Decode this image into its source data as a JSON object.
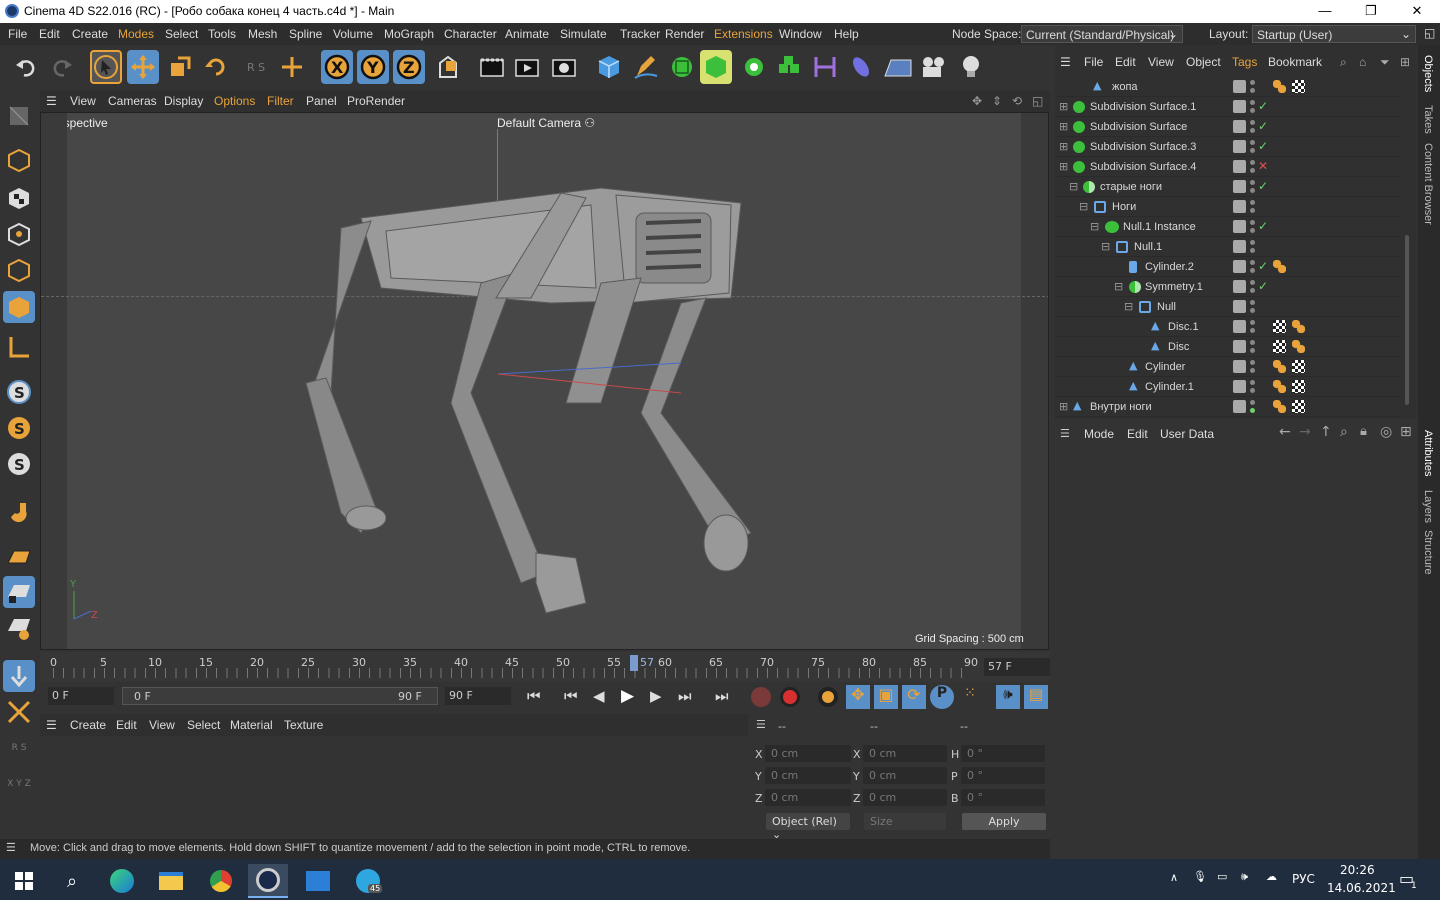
{
  "window": {
    "title": "Cinema 4D S22.016 (RC) - [Робо собака конец 4 часть.c4d *] - Main",
    "minimize": "—",
    "restore": "❐",
    "close": "✕"
  },
  "menubar": {
    "items": [
      "File",
      "Edit",
      "Create",
      "Modes",
      "Select",
      "Tools",
      "Mesh",
      "Spline",
      "Volume",
      "MoGraph",
      "Character",
      "Animate",
      "Simulate",
      "Tracker",
      "Render",
      "Extensions",
      "Window",
      "Help"
    ],
    "node_space_label": "Node Space:",
    "node_space_value": "Current (Standard/Physical)",
    "layout_label": "Layout:",
    "layout_value": "Startup (User)"
  },
  "toolbar": {
    "icons": [
      "undo-icon",
      "redo-icon",
      "select-arrow-icon",
      "move-icon",
      "scale-icon",
      "rotate-icon",
      "coord-system-icon",
      "recent-tool-icon",
      "x-axis-icon",
      "y-axis-icon",
      "z-axis-icon",
      "world-coord-icon",
      "render-region-icon",
      "render-view-icon",
      "render-settings-icon",
      "cube-icon",
      "pen-icon",
      "subdivision-icon",
      "extrude-icon",
      "cloner-icon",
      "boole-icon",
      "deformer-icon",
      "spline-mask-icon",
      "floor-icon",
      "camera-icon",
      "light-icon"
    ]
  },
  "viewport": {
    "menu": [
      "View",
      "Cameras",
      "Display",
      "Options",
      "Filter",
      "Panel",
      "ProRender"
    ],
    "label": "Perspective",
    "camera": "Default Camera",
    "grid_spacing": "Grid Spacing : 500 cm",
    "axis_y": "Y",
    "axis_z": "Z"
  },
  "timeline": {
    "ticks": [
      "0",
      "5",
      "10",
      "15",
      "20",
      "25",
      "30",
      "35",
      "40",
      "45",
      "50",
      "55",
      "60",
      "65",
      "70",
      "75",
      "80",
      "85",
      "90"
    ],
    "current_marker": "57",
    "current_frame": "57 F"
  },
  "playbar": {
    "start": "0 F",
    "range_start": "0 F",
    "range_end": "90 F",
    "end": "90 F"
  },
  "material_menu": [
    "Create",
    "Edit",
    "View",
    "Select",
    "Material",
    "Texture"
  ],
  "coords": {
    "headers": [
      "--",
      "--",
      "--"
    ],
    "rows": [
      {
        "a": "X",
        "av": "0 cm",
        "b": "X",
        "bv": "0 cm",
        "c": "H",
        "cv": "0 °"
      },
      {
        "a": "Y",
        "av": "0 cm",
        "b": "Y",
        "bv": "0 cm",
        "c": "P",
        "cv": "0 °"
      },
      {
        "a": "Z",
        "av": "0 cm",
        "b": "Z",
        "bv": "0 cm",
        "c": "B",
        "cv": "0 °"
      }
    ],
    "mode": "Object (Rel)",
    "size": "Size",
    "apply": "Apply"
  },
  "status": "Move: Click and drag to move elements. Hold down SHIFT to quantize movement / add to the selection in point mode, CTRL to remove.",
  "objects": {
    "menu": [
      "File",
      "Edit",
      "View",
      "Object",
      "Tags",
      "Bookmark"
    ],
    "rows": [
      {
        "name": "жопа",
        "icon": "polygon-icon",
        "status": "",
        "tags": [
          "material-tag-icon",
          "texture-tag-icon"
        ]
      },
      {
        "name": "Subdivision Surface.1",
        "icon": "subdivision-icon",
        "status": "✓",
        "tags": []
      },
      {
        "name": "Subdivision Surface",
        "icon": "subdivision-icon",
        "status": "✓",
        "tags": []
      },
      {
        "name": "Subdivision Surface.3",
        "icon": "subdivision-icon",
        "status": "✓",
        "tags": []
      },
      {
        "name": "Subdivision Surface.4",
        "icon": "subdivision-icon",
        "status": "✕",
        "tags": []
      },
      {
        "name": "старые ноги",
        "icon": "symmetry-icon",
        "status": "✓",
        "tags": []
      },
      {
        "name": "Ноги",
        "icon": "null-icon",
        "status": "",
        "tags": []
      },
      {
        "name": "Null.1 Instance",
        "icon": "instance-icon",
        "status": "✓",
        "tags": []
      },
      {
        "name": "Null.1",
        "icon": "null-icon",
        "status": "",
        "tags": []
      },
      {
        "name": "Cylinder.2",
        "icon": "cylinder-icon",
        "status": "✓",
        "tags": [
          "material-tag-icon"
        ]
      },
      {
        "name": "Symmetry.1",
        "icon": "symmetry-icon",
        "status": "✓",
        "tags": []
      },
      {
        "name": "Null",
        "icon": "null-icon",
        "status": "",
        "tags": []
      },
      {
        "name": "Disc.1",
        "icon": "polygon-icon",
        "status": "",
        "tags": [
          "texture-tag-icon",
          "material-tag-icon"
        ]
      },
      {
        "name": "Disc",
        "icon": "polygon-icon",
        "status": "",
        "tags": [
          "texture-tag-icon",
          "material-tag-icon"
        ]
      },
      {
        "name": "Cylinder",
        "icon": "polygon-icon",
        "status": "",
        "tags": [
          "material-tag-icon",
          "texture-tag-icon"
        ]
      },
      {
        "name": "Cylinder.1",
        "icon": "polygon-icon",
        "status": "",
        "tags": [
          "material-tag-icon",
          "texture-tag-icon"
        ]
      },
      {
        "name": "Внутри ноги",
        "icon": "polygon-icon",
        "status": "",
        "tags": [
          "material-tag-icon",
          "texture-tag-icon"
        ]
      }
    ]
  },
  "attributes": {
    "menu": [
      "Mode",
      "Edit",
      "User Data"
    ]
  },
  "side_tabs": [
    "Objects",
    "Takes",
    "Content Browser",
    "Attributes",
    "Layers",
    "Structure"
  ],
  "taskbar": {
    "lang": "РУС",
    "time": "20:26",
    "date": "14.06.2021",
    "badge": "45",
    "notif": "1"
  },
  "colors": {
    "accent_orange": "#e8a33a",
    "active_blue": "#5a90c8",
    "check_green": "#6fd26f",
    "cross_red": "#e05050"
  }
}
